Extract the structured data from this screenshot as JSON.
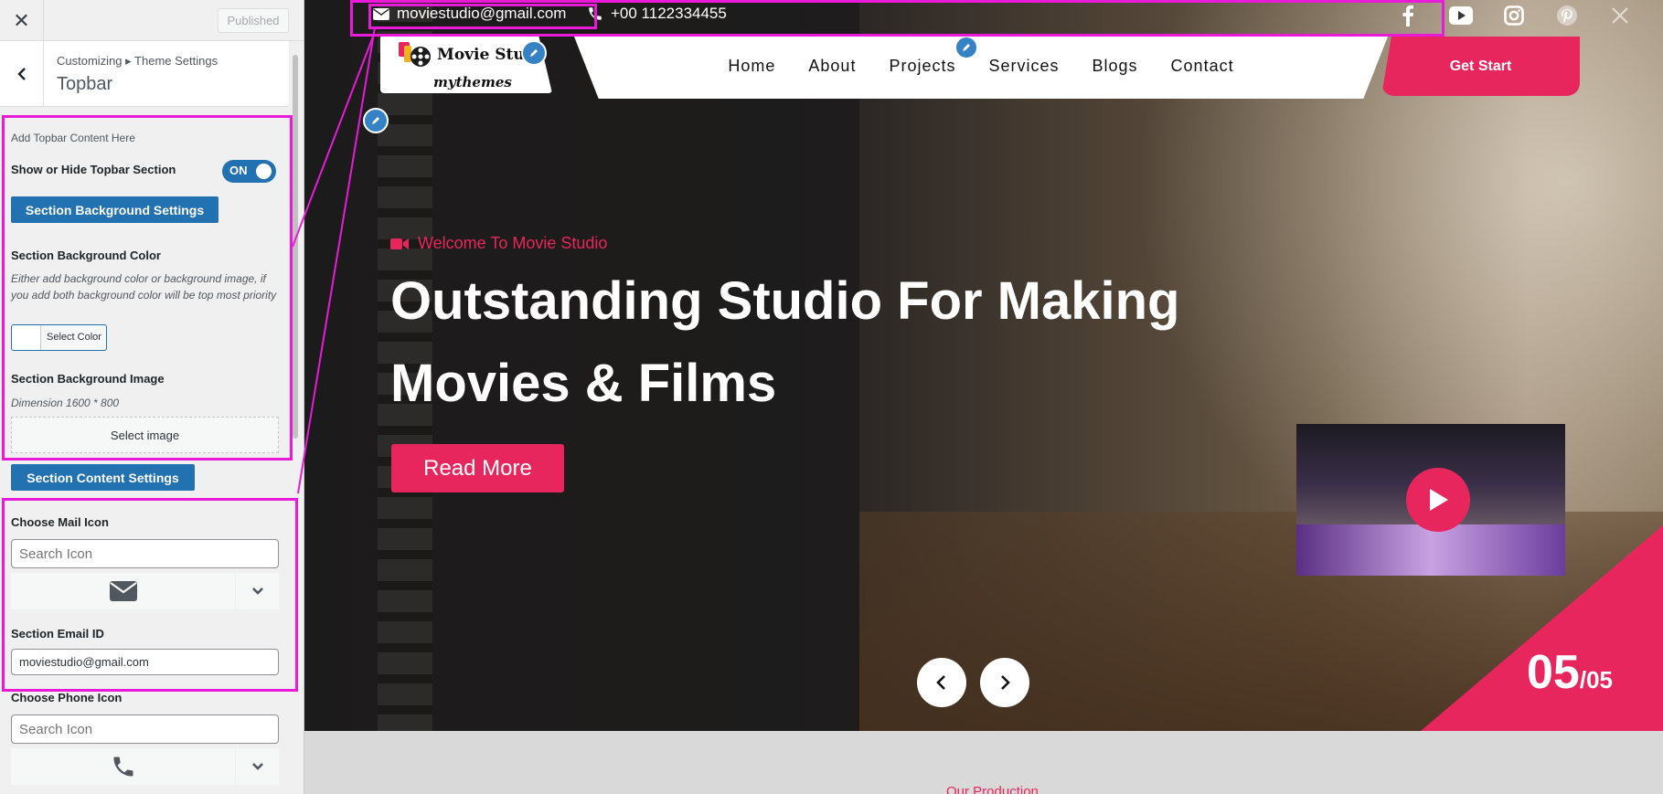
{
  "customizer": {
    "published_label": "Published",
    "breadcrumb": "Customizing ▸ Theme Settings",
    "section_title": "Topbar",
    "add_content_label": "Add Topbar Content Here",
    "show_hide_label": "Show or Hide Topbar Section",
    "toggle_state": "ON",
    "bg_settings_button": "Section Background Settings",
    "bg_color_label": "Section Background Color",
    "bg_color_desc": "Either add background color or background image, if you add both background color will be top most priority",
    "select_color_label": "Select Color",
    "bg_image_label": "Section Background Image",
    "bg_image_dimension": "Dimension 1600 * 800",
    "select_image_label": "Select image",
    "content_settings_button": "Section Content Settings",
    "mail_icon_label": "Choose Mail Icon",
    "mail_icon_placeholder": "Search Icon",
    "email_id_label": "Section Email ID",
    "email_id_value": "moviestudio@gmail.com",
    "phone_icon_label": "Choose Phone Icon",
    "phone_icon_placeholder": "Search Icon"
  },
  "site": {
    "topbar": {
      "email": "moviestudio@gmail.com",
      "phone": "+00 1122334455",
      "social_icons": [
        "facebook-icon",
        "youtube-icon",
        "instagram-icon",
        "pinterest-icon",
        "x-icon"
      ]
    },
    "logo": {
      "title": "Movie Studio",
      "subtitle": "mythemes"
    },
    "nav": [
      "Home",
      "About",
      "Projects",
      "Services",
      "Blogs",
      "Contact"
    ],
    "cta_label": "Get Start",
    "hero": {
      "welcome": "Welcome To Movie Studio",
      "headline_line1": "Outstanding Studio For Making",
      "headline_line2": "Movies & Films",
      "read_more": "Read More",
      "counter_current": "05",
      "counter_total": "/05"
    },
    "next_section_label": "Our Production"
  },
  "colors": {
    "accent": "#e8265e",
    "wp_blue": "#2271b1",
    "highlight": "#e91bd8"
  }
}
